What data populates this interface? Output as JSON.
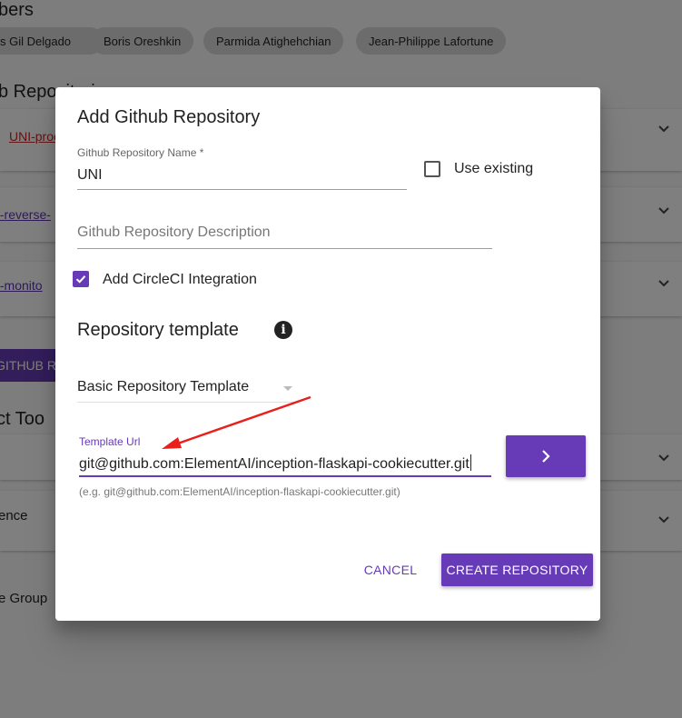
{
  "background": {
    "members_title": "bers",
    "members": [
      "s Gil Delgado",
      "Boris Oreshkin",
      "Parmida Atighehchian",
      "Jean-Philippe Lafortune"
    ],
    "repos_title": "b Repositori",
    "repos": [
      "UNI-proc",
      "I-reverse-",
      "I-monito"
    ],
    "add_github_button": "GITHUB R",
    "tools_title": "ct Too",
    "labels": [
      "ence",
      "e Group"
    ]
  },
  "dialog": {
    "title": "Add Github Repository",
    "repo_name": {
      "label": "Github Repository Name *",
      "value": "UNI"
    },
    "use_existing": {
      "label": "Use existing",
      "checked": false
    },
    "description": {
      "placeholder": "Github Repository Description"
    },
    "circleci": {
      "label": "Add CircleCI Integration",
      "checked": true
    },
    "template_section": {
      "title": "Repository template",
      "info_icon": "info-icon"
    },
    "template_select": {
      "value": "Basic Repository Template"
    },
    "template_url": {
      "label": "Template Url",
      "value": "git@github.com:ElementAI/inception-flaskapi-cookiecutter.git",
      "hint": "(e.g. git@github.com:ElementAI/inception-flaskapi-cookiecutter.git)"
    },
    "go_button_icon": "chevron-right-icon",
    "cancel_label": "CANCEL",
    "create_label": "CREATE REPOSITORY"
  },
  "colors": {
    "accent": "#673ab7",
    "annotation_arrow": "#e8201c"
  }
}
